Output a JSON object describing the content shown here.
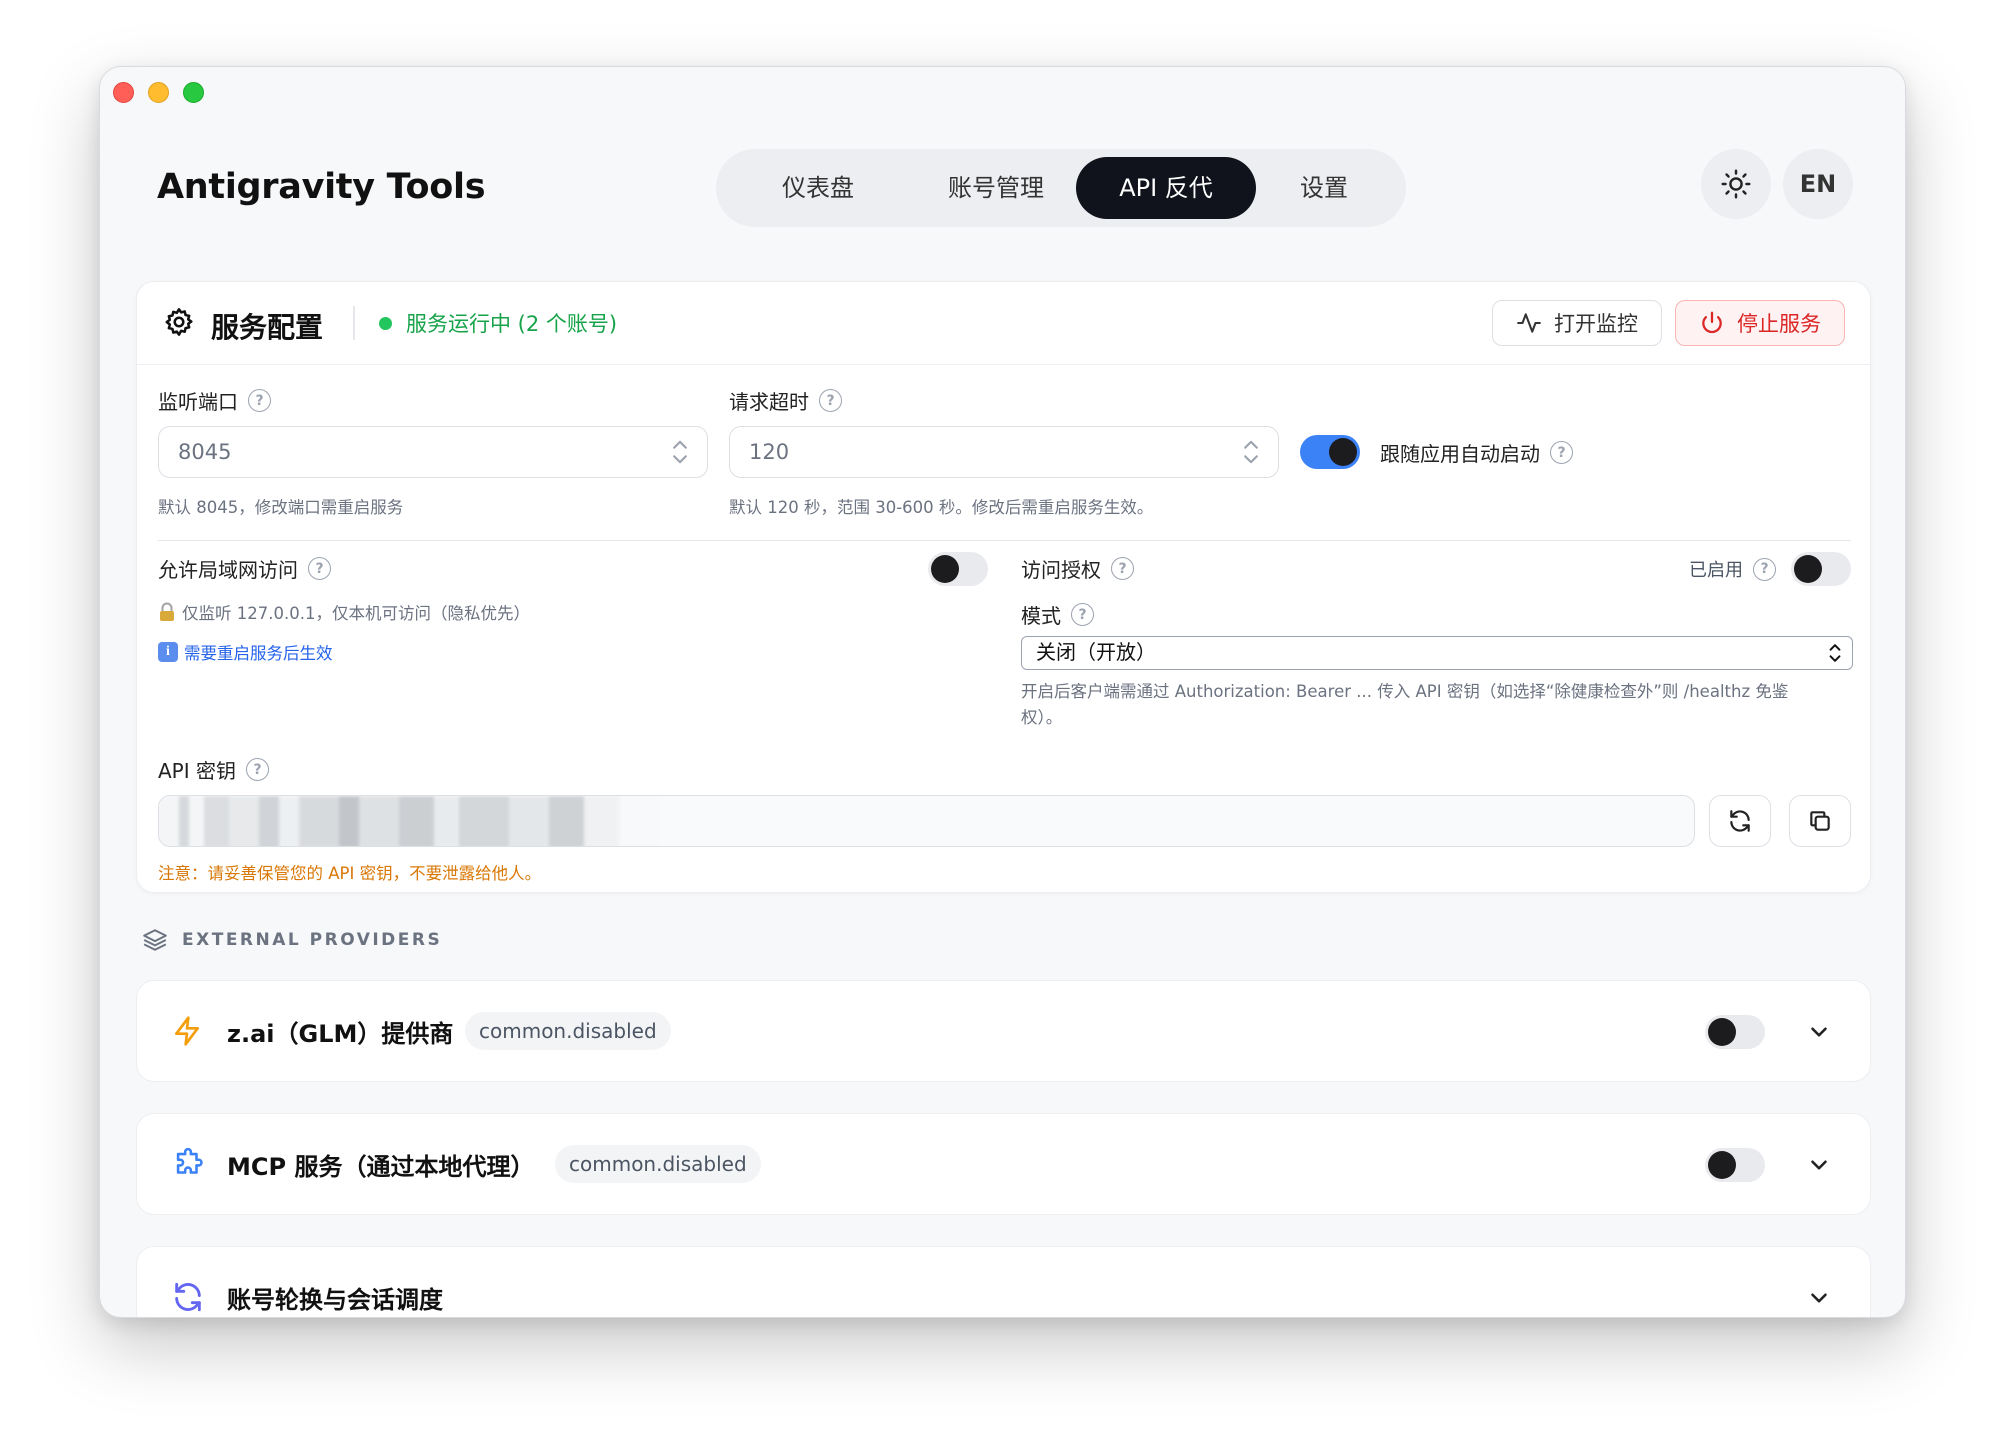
{
  "app": {
    "title": "Antigravity Tools",
    "lang_button": "EN"
  },
  "nav": {
    "tabs": [
      {
        "label": "仪表盘"
      },
      {
        "label": "账号管理"
      },
      {
        "label": "API 反代"
      },
      {
        "label": "设置"
      }
    ],
    "active": "API 反代"
  },
  "service": {
    "title": "服务配置",
    "status": "服务运行中 (2 个账号)",
    "open_monitor_label": "打开监控",
    "stop_service_label": "停止服务",
    "port": {
      "label": "监听端口",
      "value": "8045",
      "hint": "默认 8045，修改端口需重启服务"
    },
    "timeout": {
      "label": "请求超时",
      "value": "120",
      "hint": "默认 120 秒，范围 30-600 秒。修改后需重启服务生效。"
    },
    "autostart": {
      "label": "跟随应用自动启动",
      "enabled": true
    },
    "lan": {
      "label": "允许局域网访问",
      "enabled": false,
      "info": "仅监听 127.0.0.1，仅本机可访问（隐私优先）",
      "restart_note": "需要重启服务后生效"
    },
    "auth": {
      "label": "访问授权",
      "enabled_label": "已启用",
      "enabled": false,
      "mode_label": "模式",
      "mode_value": "关闭（开放）",
      "hint_line1": "开启后客户端需通过 Authorization: Bearer ... 传入 API 密钥（如选择“除健康检查外”则 /healthz 免鉴",
      "hint_line2": "权）。"
    },
    "api_key": {
      "label": "API 密钥",
      "warning": "注意：请妥善保管您的 API 密钥，不要泄露给他人。"
    }
  },
  "external": {
    "heading": "EXTERNAL PROVIDERS",
    "providers": [
      {
        "title": "z.ai（GLM）提供商",
        "badge": "common.disabled",
        "enabled": false,
        "icon": "bolt-icon"
      },
      {
        "title": "MCP 服务（通过本地代理）",
        "badge": "common.disabled",
        "enabled": false,
        "icon": "puzzle-icon"
      },
      {
        "title": "账号轮换与会话调度",
        "icon": "refresh-icon"
      }
    ]
  },
  "colors": {
    "accent": "#3b82f6",
    "running": "#16a34a",
    "danger": "#dc2626",
    "warning": "#d97706",
    "link": "#2563eb"
  }
}
